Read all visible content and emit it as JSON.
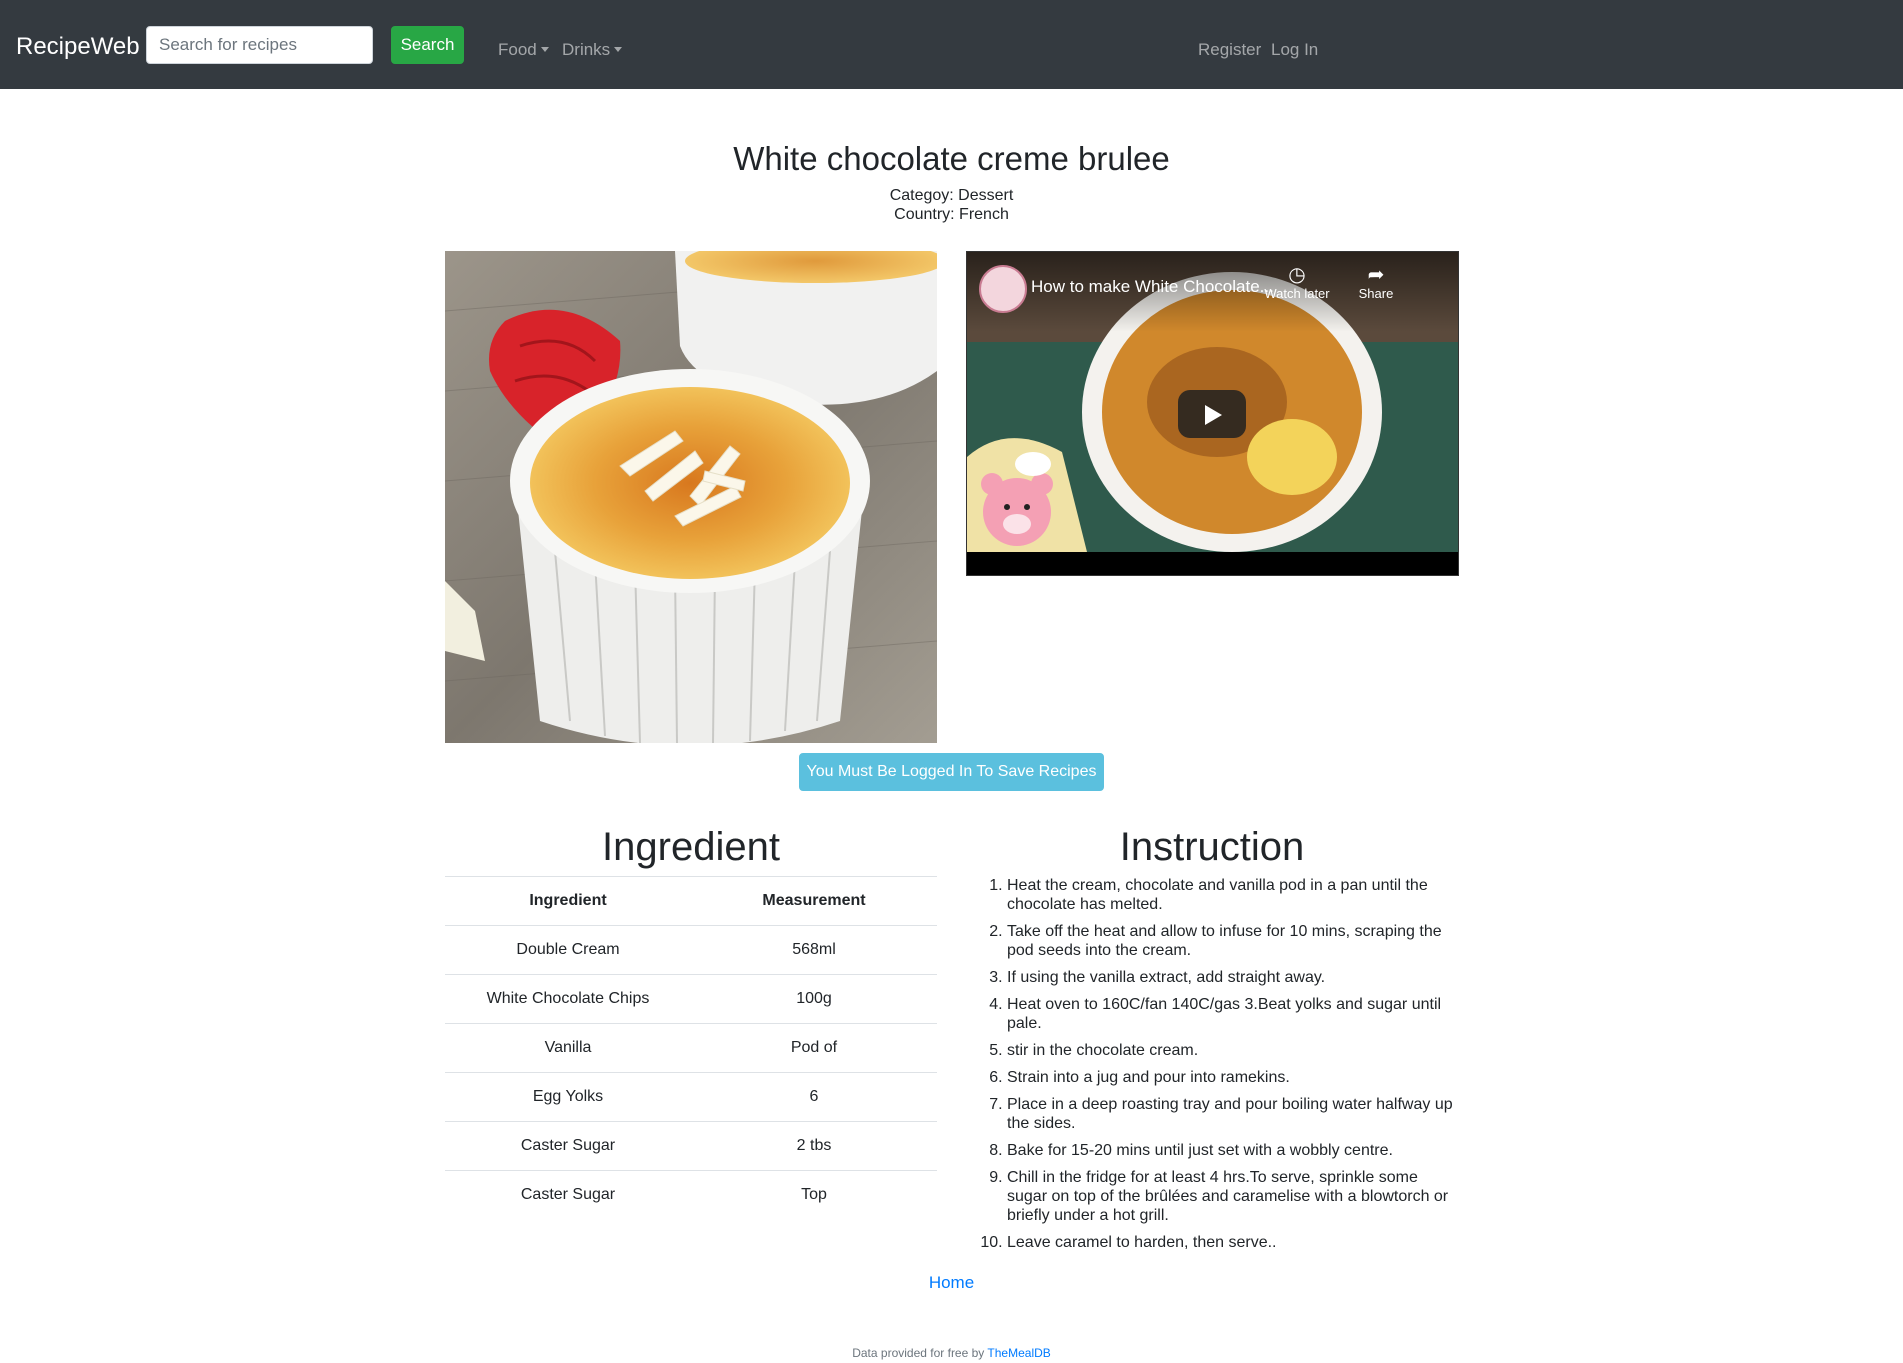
{
  "navbar": {
    "brand": "RecipeWeb",
    "search": {
      "placeholder": "Search for recipes",
      "value": "",
      "button_label": "Search"
    },
    "menus": [
      "Food",
      "Drinks"
    ],
    "auth_links": [
      "Register",
      "Log In"
    ]
  },
  "recipe": {
    "title": "White chocolate creme brulee",
    "category": "Categoy: Dessert",
    "country": "Country: French"
  },
  "video": {
    "title": "How to make White Chocolate...",
    "watch_later_label": "Watch later",
    "share_label": "Share"
  },
  "save_button_label": "You Must Be Logged In To Save Recipes",
  "ingredients": {
    "heading": "Ingredient",
    "columns": [
      "Ingredient",
      "Measurement"
    ],
    "rows": [
      [
        "Double Cream",
        "568ml"
      ],
      [
        "White Chocolate Chips",
        "100g"
      ],
      [
        "Vanilla",
        "Pod of"
      ],
      [
        "Egg Yolks",
        "6"
      ],
      [
        "Caster Sugar",
        "2 tbs"
      ],
      [
        "Caster Sugar",
        "Top"
      ]
    ]
  },
  "instructions": {
    "heading": "Instruction",
    "steps": [
      "Heat the cream, chocolate and vanilla pod in a pan until the chocolate has melted.",
      "Take off the heat and allow to infuse for 10 mins, scraping the pod seeds into the cream.",
      "If using the vanilla extract, add straight away.",
      "Heat oven to 160C/fan 140C/gas 3.Beat yolks and sugar until pale.",
      "stir in the chocolate cream.",
      "Strain into a jug and pour into ramekins.",
      "Place in a deep roasting tray and pour boiling water halfway up the sides.",
      "Bake for 15-20 mins until just set with a wobbly centre.",
      "Chill in the fridge for at least 4 hrs.To serve, sprinkle some sugar on top of the brûlées and caramelise with a blowtorch or briefly under a hot grill.",
      "Leave caramel to harden, then serve.."
    ]
  },
  "footer": {
    "home_link": "Home",
    "credit_text": "Data provided for free by",
    "credit_link": "TheMealDB"
  },
  "colors": {
    "navbar_bg": "#343a40",
    "search_button": "#28a745",
    "save_button": "#5bc0de",
    "link": "#007bff"
  }
}
